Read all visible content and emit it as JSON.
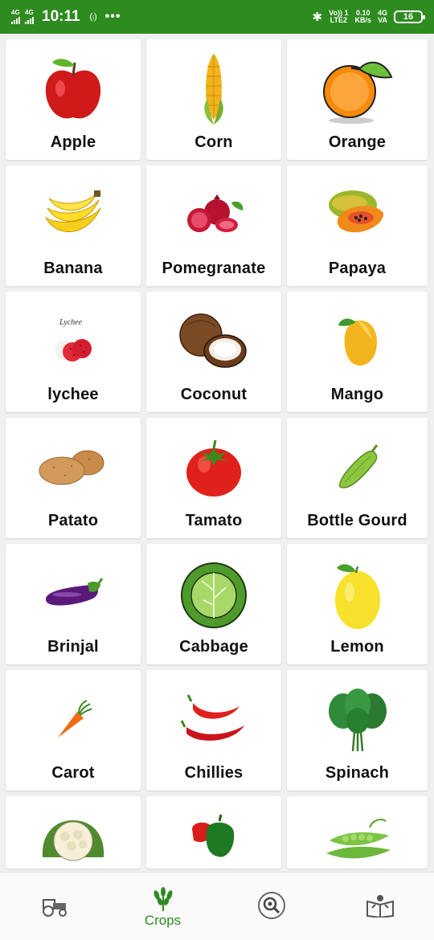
{
  "status": {
    "sim1": "4G",
    "sim2": "4G",
    "time": "10:11",
    "hotspot": "(ᵢ)",
    "more": "•••",
    "volte_top": "Vo)) 1",
    "volte_bottom": "LTE2",
    "speed_top": "0.10",
    "speed_bottom": "KB/s",
    "net_top": "4G",
    "net_bottom": "VA",
    "battery": "16"
  },
  "crops": [
    {
      "name": "Apple",
      "icon": "apple-icon"
    },
    {
      "name": "Corn",
      "icon": "corn-icon"
    },
    {
      "name": "Orange",
      "icon": "orange-icon"
    },
    {
      "name": "Banana",
      "icon": "banana-icon"
    },
    {
      "name": "Pomegranate",
      "icon": "pomegranate-icon"
    },
    {
      "name": "Papaya",
      "icon": "papaya-icon"
    },
    {
      "name": "lychee",
      "icon": "lychee-icon",
      "caption": "Lychee"
    },
    {
      "name": "Coconut",
      "icon": "coconut-icon"
    },
    {
      "name": "Mango",
      "icon": "mango-icon"
    },
    {
      "name": "Patato",
      "icon": "potato-icon"
    },
    {
      "name": "Tamato",
      "icon": "tomato-icon"
    },
    {
      "name": "Bottle Gourd",
      "icon": "bottle-gourd-icon"
    },
    {
      "name": "Brinjal",
      "icon": "brinjal-icon"
    },
    {
      "name": "Cabbage",
      "icon": "cabbage-icon"
    },
    {
      "name": "Lemon",
      "icon": "lemon-icon"
    },
    {
      "name": "Carot",
      "icon": "carrot-icon"
    },
    {
      "name": "Chillies",
      "icon": "chillies-icon"
    },
    {
      "name": "Spinach",
      "icon": "spinach-icon"
    }
  ],
  "partial_row": [
    {
      "icon": "cauliflower-icon"
    },
    {
      "icon": "capsicum-icon"
    },
    {
      "icon": "peas-icon"
    }
  ],
  "nav": {
    "tabs": [
      {
        "icon": "tractor-icon",
        "label": ""
      },
      {
        "icon": "wheat-icon",
        "label": "Crops",
        "active": true
      },
      {
        "icon": "magnify-bug-icon",
        "label": ""
      },
      {
        "icon": "farmer-book-icon",
        "label": ""
      }
    ]
  },
  "colors": {
    "primary": "#2e8b1f"
  }
}
